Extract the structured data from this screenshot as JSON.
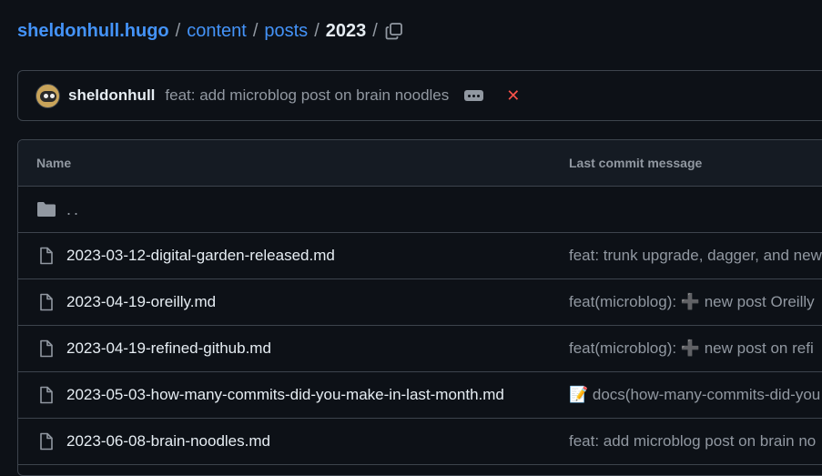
{
  "breadcrumb": {
    "repo": "sheldonhull.hugo",
    "seg1": "content",
    "seg2": "posts",
    "current": "2023",
    "sep": "/"
  },
  "icons": {
    "copy": "copy-icon",
    "folder": "folder-icon",
    "file": "file-icon",
    "ellipsis": "ellipsis-icon",
    "fail": "x-icon"
  },
  "commit": {
    "author": "sheldonhull",
    "message": "feat: add microblog post on brain noodles",
    "status_glyph": "✕"
  },
  "table": {
    "headers": {
      "name": "Name",
      "message": "Last commit message"
    },
    "up_dir": "..",
    "rows": [
      {
        "name": "2023-03-12-digital-garden-released.md",
        "message": "feat: trunk upgrade, dagger, and new"
      },
      {
        "name": "2023-04-19-oreilly.md",
        "message": "feat(microblog): ➕ new post Oreilly"
      },
      {
        "name": "2023-04-19-refined-github.md",
        "message": "feat(microblog): ➕ new post on refi"
      },
      {
        "name": "2023-05-03-how-many-commits-did-you-make-in-last-month.md",
        "message": "📝 docs(how-many-commits-did-you"
      },
      {
        "name": "2023-06-08-brain-noodles.md",
        "message": "feat: add microblog post on brain no"
      }
    ]
  },
  "colors": {
    "background": "#0d1117",
    "link": "#4493f8",
    "muted": "#9198a1",
    "border": "#3d444d",
    "danger": "#f85149"
  }
}
